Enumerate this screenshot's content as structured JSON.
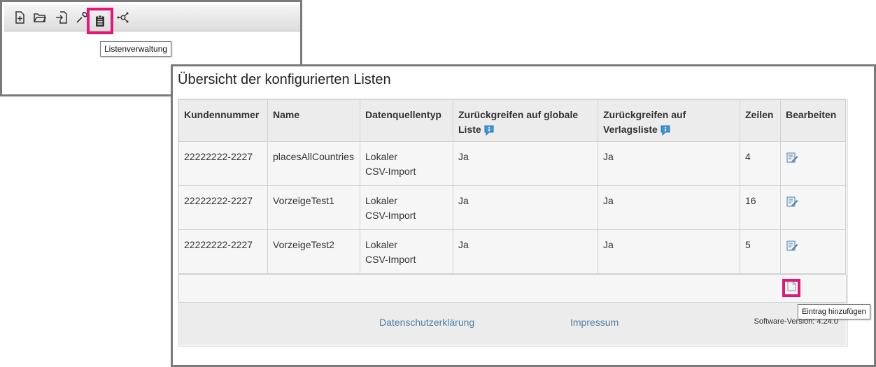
{
  "toolbar": {
    "buttons": [
      {
        "name": "new-file-icon"
      },
      {
        "name": "open-folder-icon"
      },
      {
        "name": "import-icon"
      },
      {
        "name": "wrench-icon"
      },
      {
        "name": "clipboard-list-icon"
      },
      {
        "name": "network-icon"
      }
    ],
    "tooltip": "Listenverwaltung"
  },
  "page": {
    "title": "Übersicht der konfigurierten Listen"
  },
  "table": {
    "headers": {
      "kundennummer": "Kundennummer",
      "name": "Name",
      "datenquellentyp": "Datenquellentyp",
      "global_line1": "Zurückgreifen auf globale",
      "global_line2": "Liste",
      "verlag_line1": "Zurückgreifen auf",
      "verlag_line2": "Verlagsliste",
      "zeilen": "Zeilen",
      "bearbeiten": "Bearbeiten"
    },
    "rows": [
      {
        "kundennummer": "22222222-2227",
        "name": "placesAllCountries",
        "typ1": "Lokaler",
        "typ2": "CSV-Import",
        "global": "Ja",
        "verlag": "Ja",
        "zeilen": "4"
      },
      {
        "kundennummer": "22222222-2227",
        "name": "VorzeigeTest1",
        "typ1": "Lokaler",
        "typ2": "CSV-Import",
        "global": "Ja",
        "verlag": "Ja",
        "zeilen": "16"
      },
      {
        "kundennummer": "22222222-2227",
        "name": "VorzeigeTest2",
        "typ1": "Lokaler",
        "typ2": "CSV-Import",
        "global": "Ja",
        "verlag": "Ja",
        "zeilen": "5"
      }
    ],
    "add_tooltip": "Eintrag hinzufügen"
  },
  "footer": {
    "privacy": "Datenschutzerklärung",
    "imprint": "Impressum",
    "version": "Software-Version: 4.24.0"
  },
  "colors": {
    "highlight": "#e5157a",
    "link": "#4a7fa8"
  }
}
